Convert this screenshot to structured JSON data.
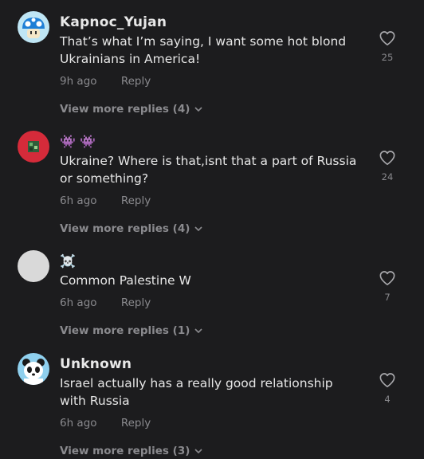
{
  "comments": [
    {
      "username": "Kapnoc_Yujan",
      "avatar_icon": "mushroom-avatar-icon",
      "text": "That’s what I’m saying, I want some hot blond Ukrainians in America!",
      "time": "9h ago",
      "reply_label": "Reply",
      "likes": "25",
      "more_replies": "View more replies (4)"
    },
    {
      "username": "👾 👾",
      "avatar_icon": "pixel-art-avatar-icon",
      "text": "Ukraine? Where is that,isnt that a part of Russia or something?",
      "time": "6h ago",
      "reply_label": "Reply",
      "likes": "24",
      "more_replies": "View more replies (4)"
    },
    {
      "username": "☠️",
      "avatar_icon": "blank-avatar-icon",
      "text": "Common Palestine W",
      "time": "6h ago",
      "reply_label": "Reply",
      "likes": "7",
      "more_replies": "View more replies (1)"
    },
    {
      "username": "Unknown",
      "avatar_icon": "panda-avatar-icon",
      "text": "Israel actually has a really good relationship with Russia",
      "time": "6h ago",
      "reply_label": "Reply",
      "likes": "4",
      "more_replies": "View more replies (3)"
    }
  ],
  "colors": {
    "background": "#1c1c1e",
    "primary_text": "#e6e6e6",
    "secondary_text": "#8a8a8e"
  }
}
